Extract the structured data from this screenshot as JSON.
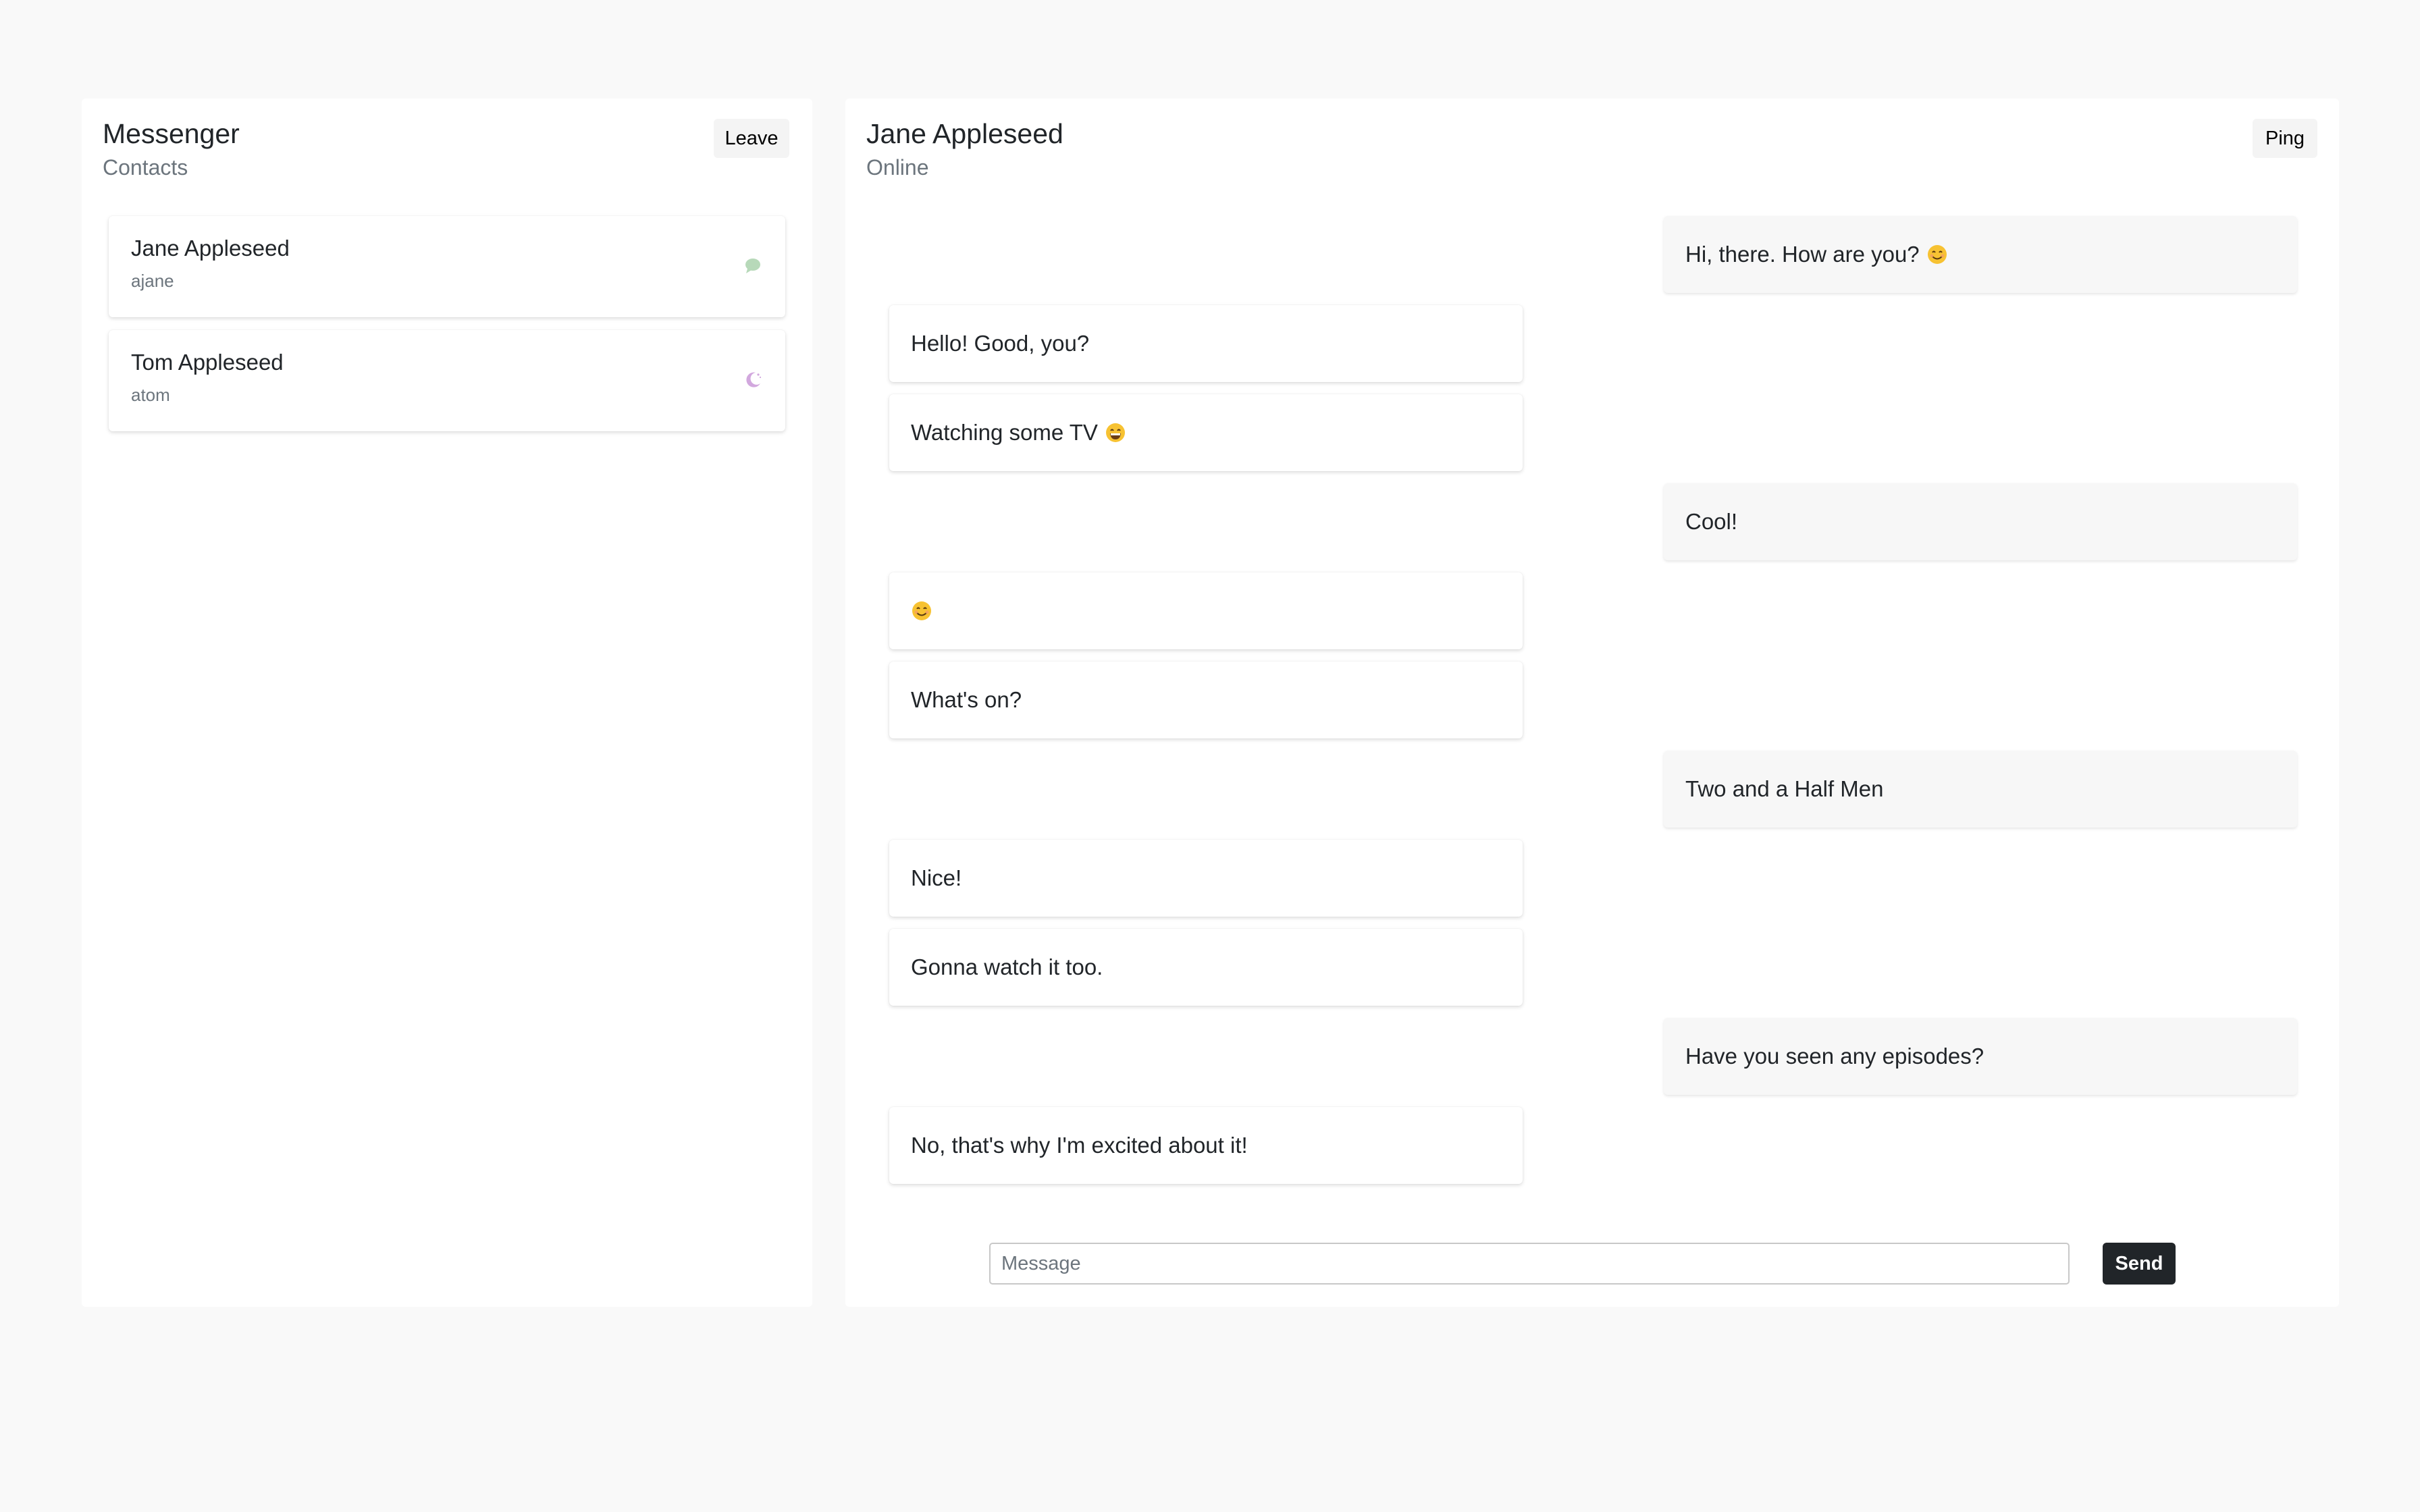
{
  "sidebar": {
    "title": "Messenger",
    "subtitle": "Contacts",
    "leave_label": "Leave",
    "contacts": [
      {
        "name": "Jane Appleseed",
        "username": "ajane",
        "status_icon": "chat-bubble-icon",
        "status_color": "#b7d9b9"
      },
      {
        "name": "Tom Appleseed",
        "username": "atom",
        "status_icon": "moon-icon",
        "status_color": "#d2a8de"
      }
    ]
  },
  "chat": {
    "title": "Jane Appleseed",
    "status": "Online",
    "ping_label": "Ping",
    "messages": [
      {
        "from": "me",
        "text": "Hi, there. How are you?",
        "emoji": "smiling-face"
      },
      {
        "from": "them",
        "text": "Hello! Good, you?"
      },
      {
        "from": "them",
        "text": "Watching some TV",
        "emoji": "grinning-face"
      },
      {
        "from": "me",
        "text": "Cool!"
      },
      {
        "from": "them",
        "text": "",
        "emoji": "smiling-face"
      },
      {
        "from": "them",
        "text": "What's on?"
      },
      {
        "from": "me",
        "text": "Two and a Half Men"
      },
      {
        "from": "them",
        "text": "Nice!"
      },
      {
        "from": "them",
        "text": "Gonna watch it too."
      },
      {
        "from": "me",
        "text": "Have you seen any episodes?"
      },
      {
        "from": "them",
        "text": "No, that's why I'm excited about it!"
      }
    ],
    "input_placeholder": "Message",
    "input_value": "",
    "send_label": "Send"
  },
  "colors": {
    "page_background": "#f9f9f9",
    "panel_background": "#ffffff",
    "my_bubble": "#f7f7f7",
    "send_button": "#212529"
  }
}
